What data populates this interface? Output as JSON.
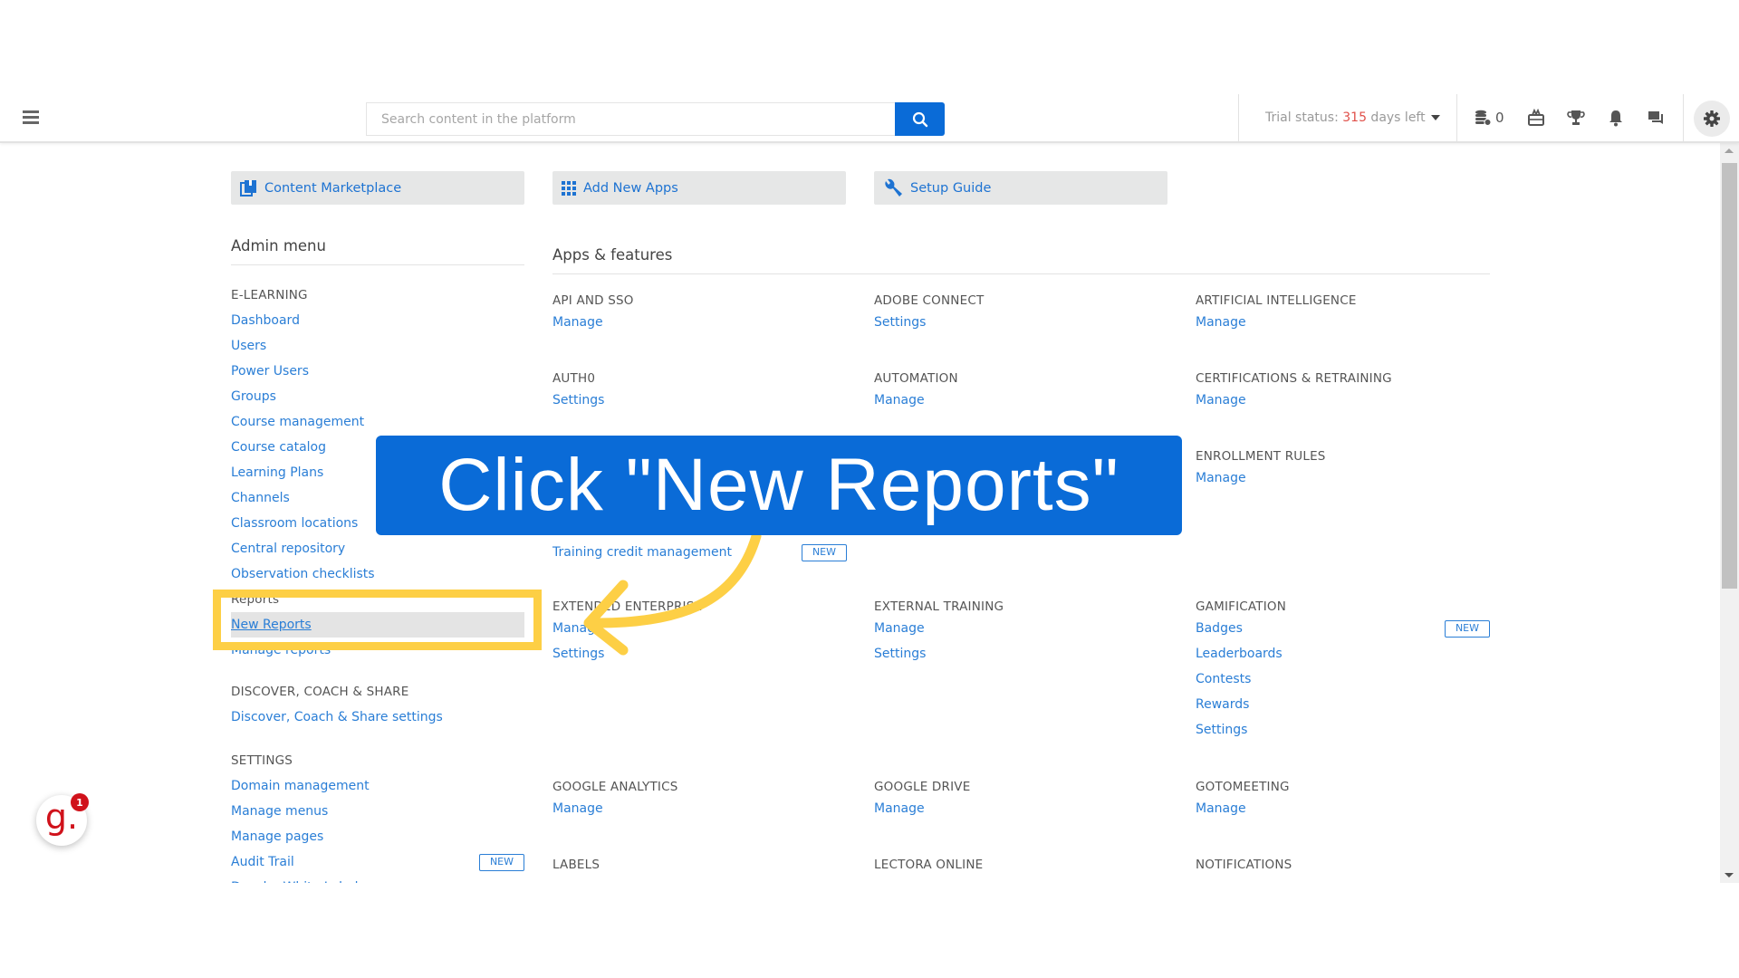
{
  "header": {
    "search_placeholder": "Search content in the platform",
    "trial_prefix": "Trial status: ",
    "trial_days": "315",
    "trial_suffix": " days left",
    "coins_count": "0",
    "icons": [
      "menu-icon",
      "search-icon",
      "coins-icon",
      "gift-icon",
      "trophy-icon",
      "bell-icon",
      "chat-icon",
      "gear-icon"
    ]
  },
  "quick_buttons": [
    {
      "label": "Content Marketplace",
      "icon": "book-icon"
    },
    {
      "label": "Add New Apps",
      "icon": "apps-grid-icon"
    },
    {
      "label": "Setup Guide",
      "icon": "wrench-icon"
    }
  ],
  "admin_menu": {
    "title": "Admin menu",
    "sections": [
      {
        "title": "E-LEARNING",
        "items": [
          "Dashboard",
          "Users",
          "Power Users",
          "Groups",
          "Course management",
          "Course catalog",
          "Learning Plans",
          "Channels",
          "Classroom locations",
          "Central repository",
          "Observation checklists"
        ]
      },
      {
        "title": "Reports",
        "items": [
          "New Reports",
          "Manage reports"
        ]
      },
      {
        "title": "DISCOVER, COACH & SHARE",
        "items": [
          "Discover, Coach & Share settings"
        ]
      },
      {
        "title": "SETTINGS",
        "items": [
          "Domain management",
          "Manage menus",
          "Manage pages",
          "Audit Trail",
          "Docebo White Label"
        ],
        "new_badge_item": "Audit Trail"
      }
    ],
    "active_item": "New Reports"
  },
  "apps": {
    "title": "Apps & features",
    "blocks": [
      {
        "title": "API AND SSO",
        "links": [
          "Manage"
        ]
      },
      {
        "title": "ADOBE CONNECT",
        "links": [
          "Settings"
        ]
      },
      {
        "title": "ARTIFICIAL INTELLIGENCE",
        "links": [
          "Manage"
        ]
      },
      {
        "title": "AUTH0",
        "links": [
          "Settings"
        ]
      },
      {
        "title": "AUTOMATION",
        "links": [
          "Manage"
        ]
      },
      {
        "title": "CERTIFICATIONS & RETRAINING",
        "links": [
          "Manage"
        ]
      },
      {
        "title": "ENROLLMENT RULES",
        "links": [
          "Manage"
        ]
      },
      {
        "title": "",
        "links": [
          "Training credit management"
        ]
      },
      {
        "title": "EXTENDED ENTERPRISE",
        "links": [
          "Manage",
          "Settings"
        ]
      },
      {
        "title": "EXTERNAL TRAINING",
        "links": [
          "Manage",
          "Settings"
        ]
      },
      {
        "title": "GAMIFICATION",
        "links": [
          "Badges",
          "Leaderboards",
          "Contests",
          "Rewards",
          "Settings"
        ]
      },
      {
        "title": "GOOGLE ANALYTICS",
        "links": [
          "Manage"
        ]
      },
      {
        "title": "GOOGLE DRIVE",
        "links": [
          "Manage"
        ]
      },
      {
        "title": "GOTOMEETING",
        "links": [
          "Manage"
        ]
      },
      {
        "title": "LABELS",
        "links": []
      },
      {
        "title": "LECTORA ONLINE",
        "links": []
      },
      {
        "title": "NOTIFICATIONS",
        "links": []
      }
    ],
    "new_badge": "NEW"
  },
  "overlay": {
    "callout_text": "Click \"New Reports\"",
    "highlight_color": "#fdcf45",
    "callout_color": "#0a6bd7"
  },
  "widget": {
    "letter": "g.",
    "badge_count": "1"
  },
  "colors": {
    "accent": "#0a6bd7",
    "link": "#2a7ed6",
    "trial_days": "#e0504a",
    "widget_red": "#d0121b"
  }
}
